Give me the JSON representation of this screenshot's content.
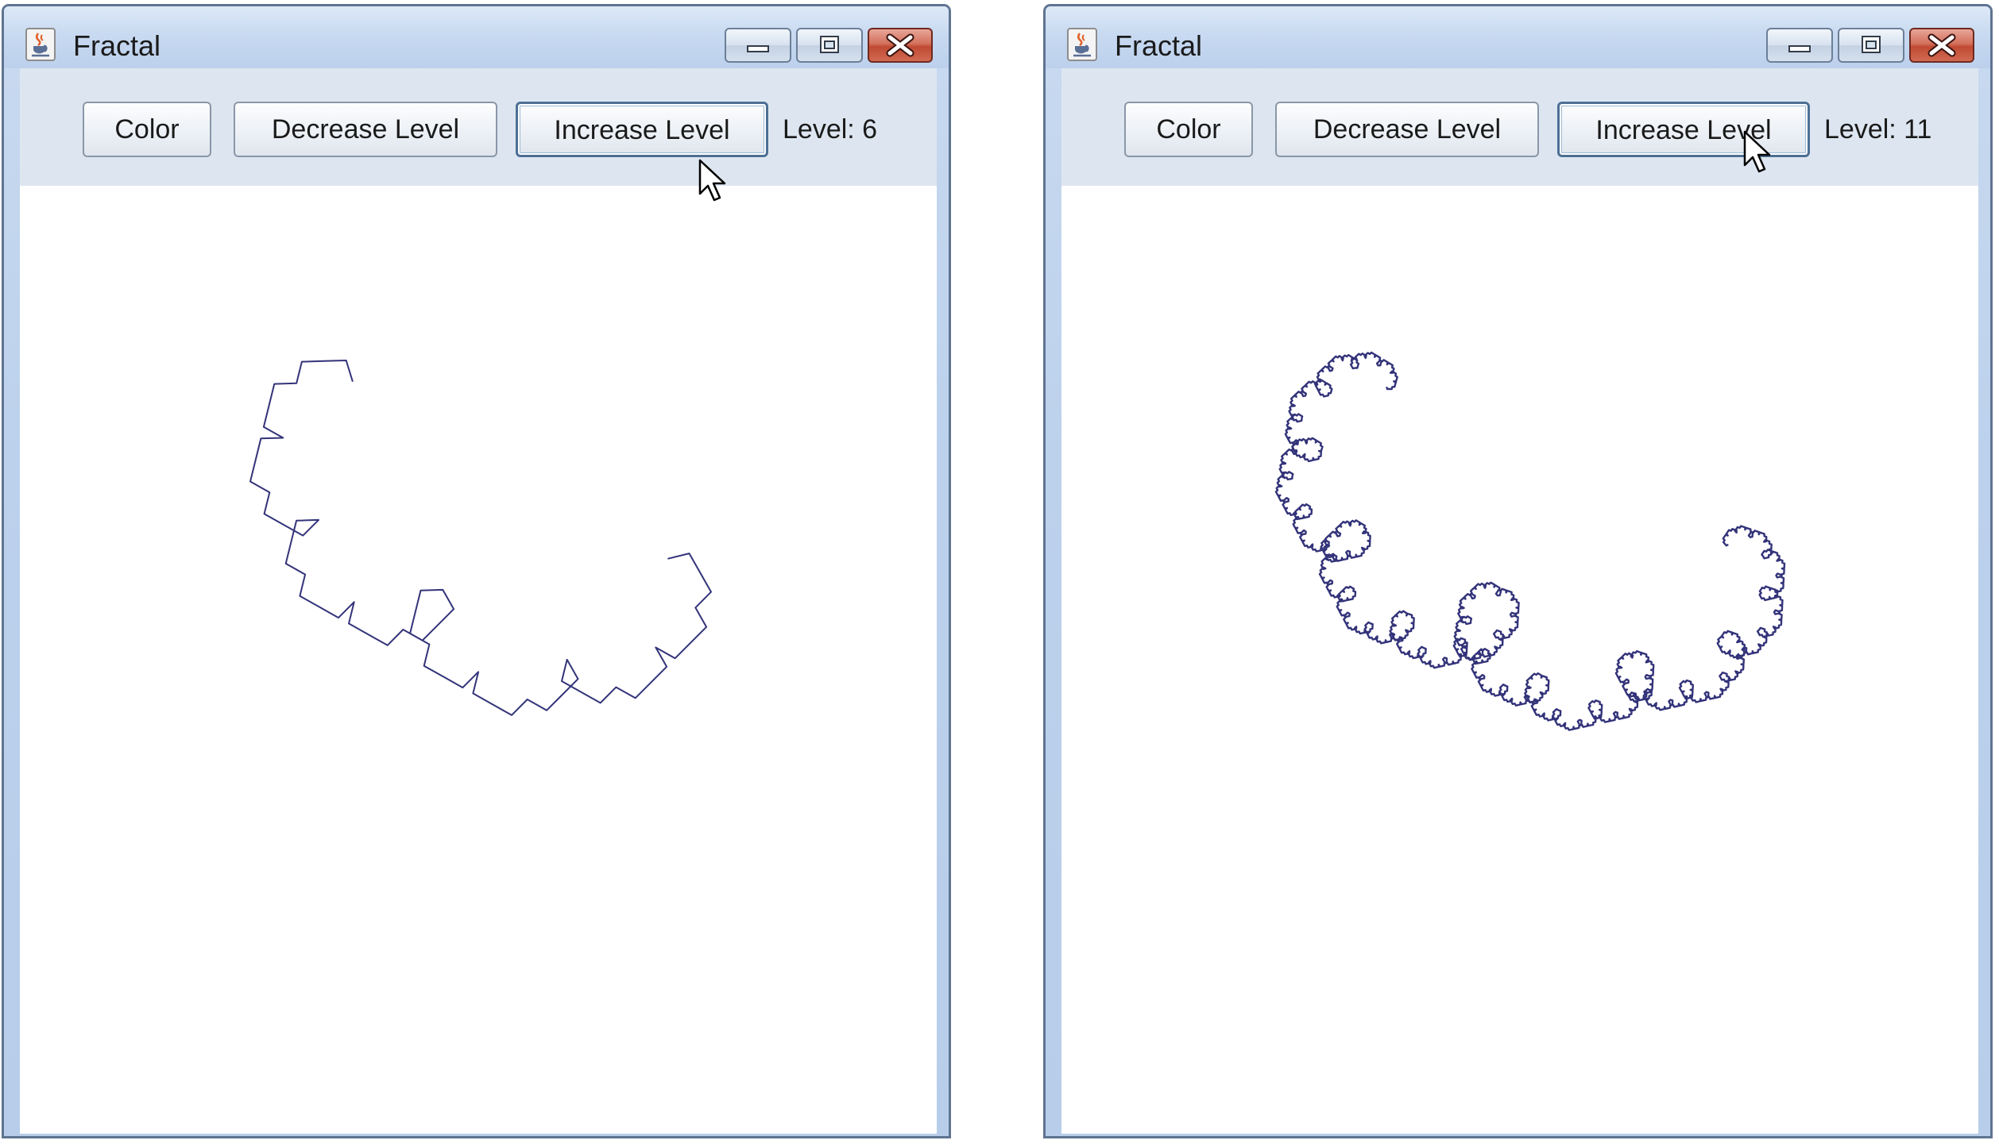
{
  "windows": [
    {
      "title": "Fractal",
      "buttons": {
        "color": "Color",
        "decrease": "Decrease Level",
        "increase": "Increase Level"
      },
      "level_label": "Level: 6",
      "level": 6
    },
    {
      "title": "Fractal",
      "buttons": {
        "color": "Color",
        "decrease": "Decrease Level",
        "increase": "Increase Level"
      },
      "level_label": "Level: 11",
      "level": 11
    }
  ],
  "colors": {
    "fractal_stroke": "#33337a",
    "toolbar_bg": "#dde6f0",
    "close_button": "#c9533b"
  },
  "icons": {
    "app": "java-cup-icon",
    "minimize": "minimize-icon",
    "maximize": "maximize-icon",
    "close": "close-icon",
    "cursor": "mouse-pointer-icon"
  }
}
